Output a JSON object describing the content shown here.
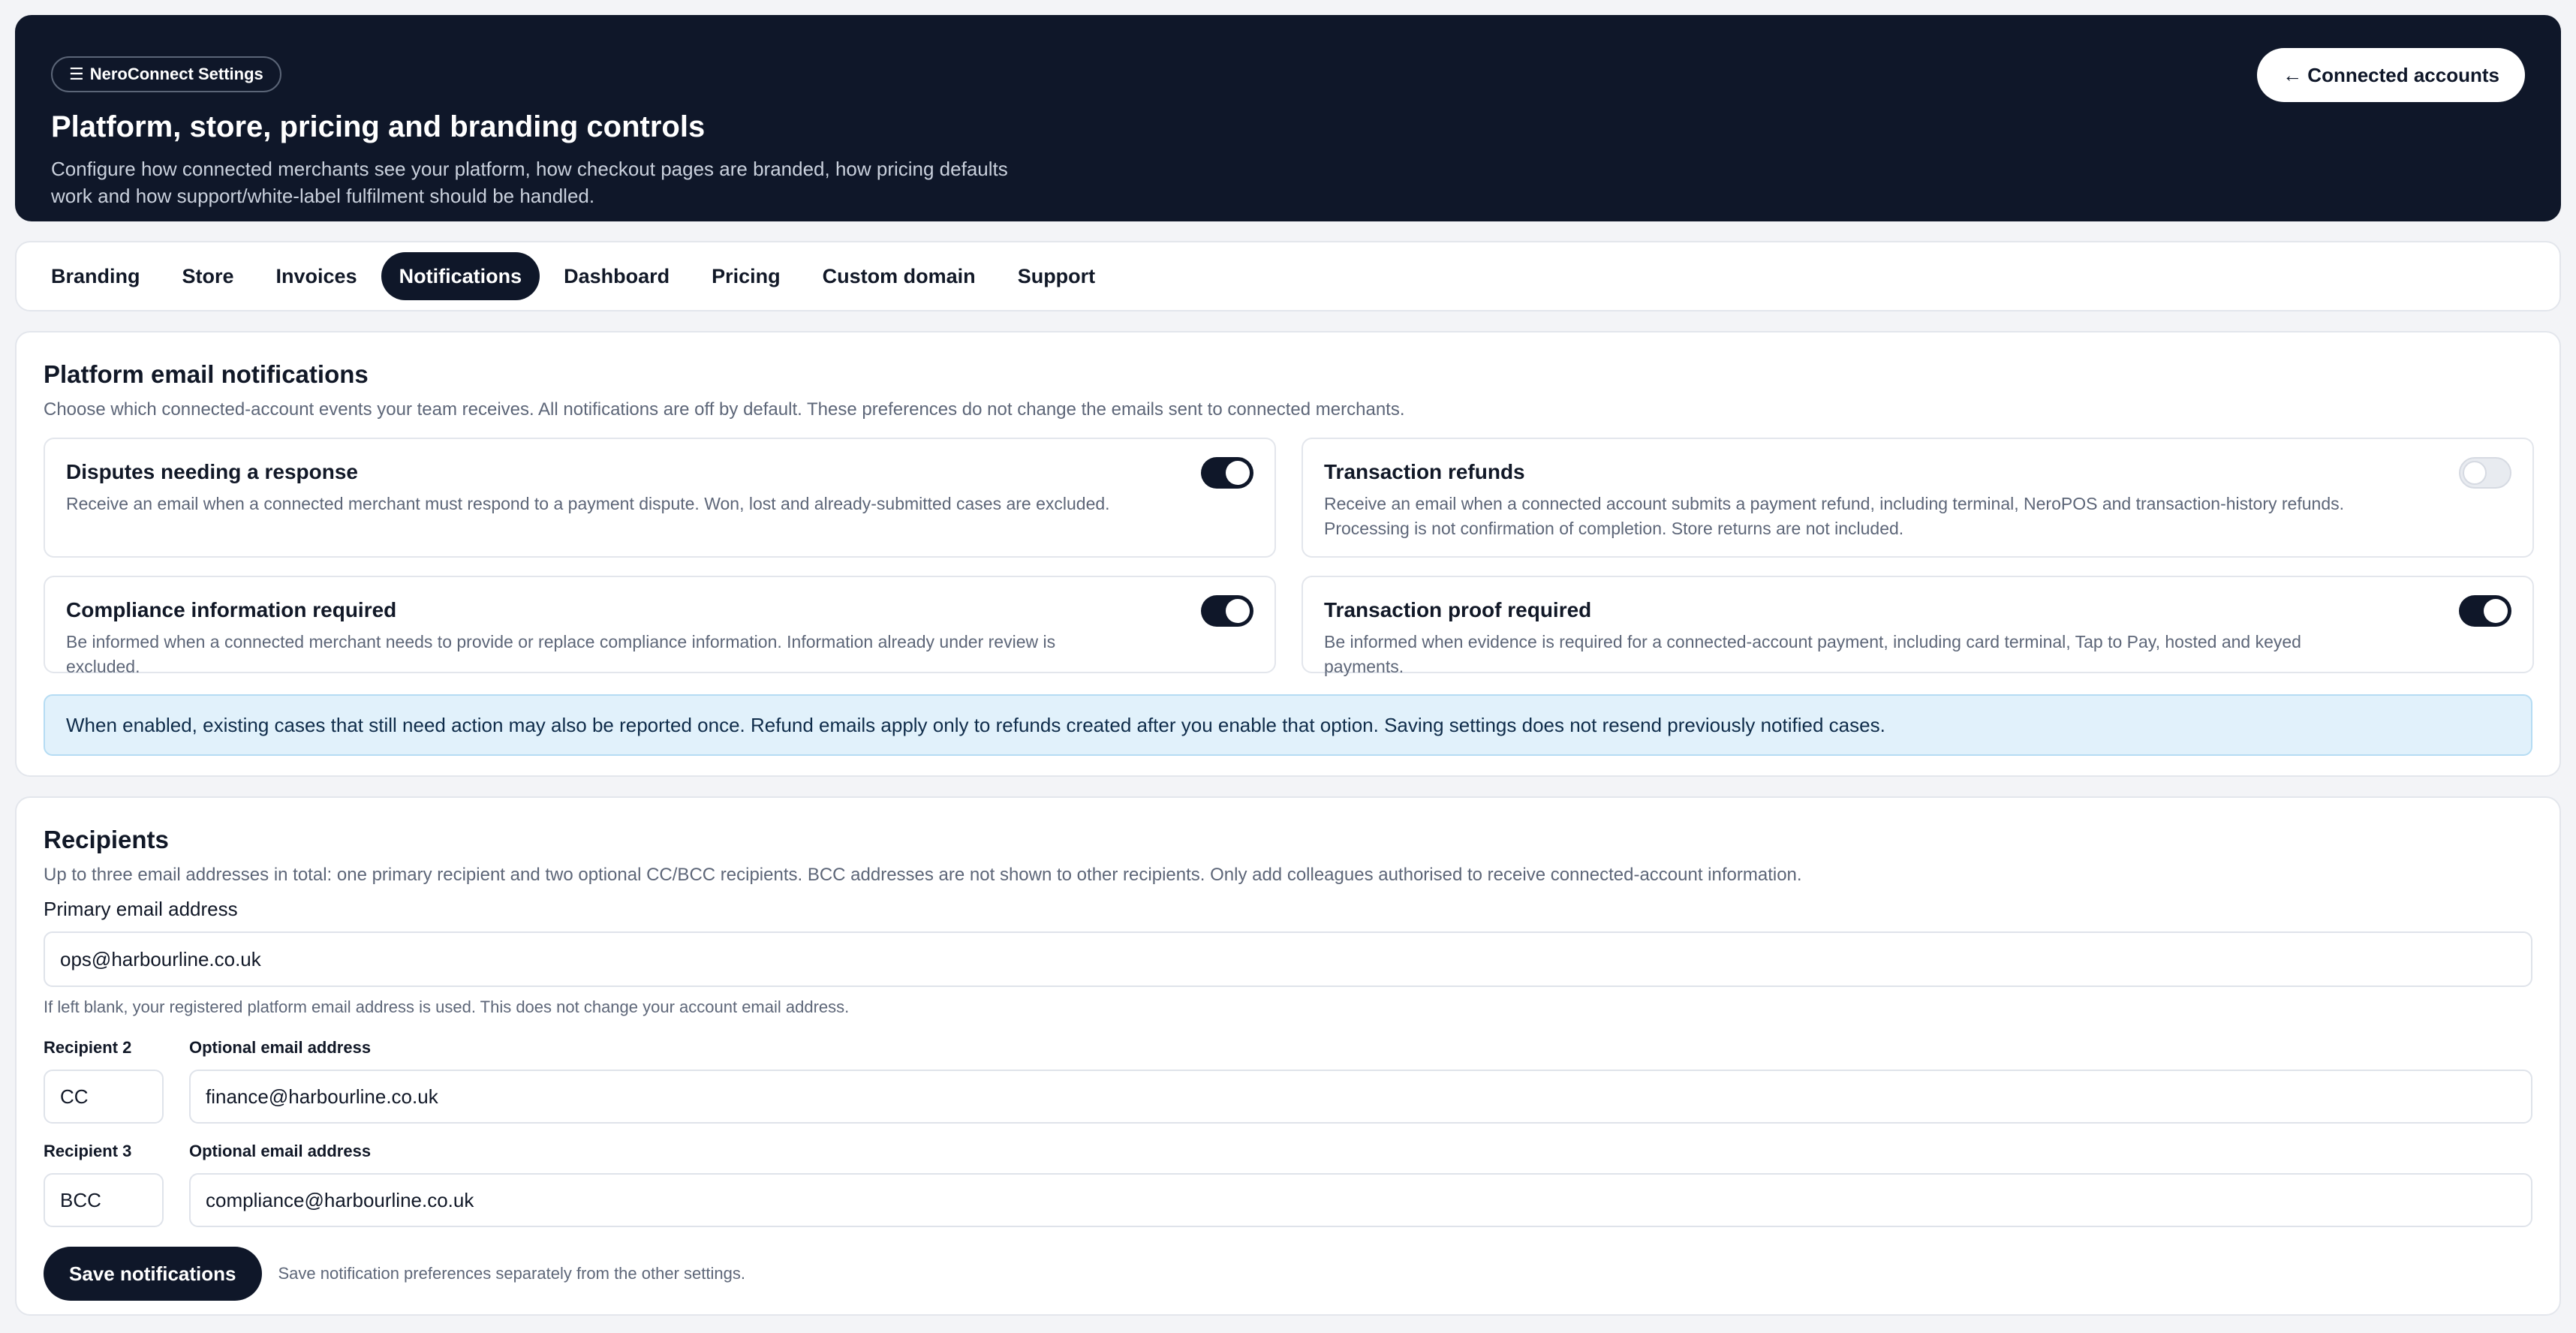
{
  "header": {
    "badge_icon": "menu-icon",
    "badge_label": "NeroConnect Settings",
    "title": "Platform, store, pricing and branding controls",
    "description": "Configure how connected merchants see your platform, how checkout pages are branded, how pricing defaults work and how support/white-label fulfilment should be handled.",
    "back_button": "← Connected accounts"
  },
  "tabs": [
    {
      "label": "Branding",
      "active": false
    },
    {
      "label": "Store",
      "active": false
    },
    {
      "label": "Invoices",
      "active": false
    },
    {
      "label": "Notifications",
      "active": true
    },
    {
      "label": "Dashboard",
      "active": false
    },
    {
      "label": "Pricing",
      "active": false
    },
    {
      "label": "Custom domain",
      "active": false
    },
    {
      "label": "Support",
      "active": false
    }
  ],
  "notifications": {
    "title": "Platform email notifications",
    "subtitle": "Choose which connected-account events your team receives. All notifications are off by default. These preferences do not change the emails sent to connected merchants.",
    "options": [
      {
        "title": "Disputes needing a response",
        "description": "Receive an email when a connected merchant must respond to a payment dispute. Won, lost and already-submitted cases are excluded.",
        "enabled": true
      },
      {
        "title": "Transaction refunds",
        "description": "Receive an email when a connected account submits a payment refund, including terminal, NeroPOS and transaction-history refunds. Processing is not confirmation of completion. Store returns are not included.",
        "enabled": false
      },
      {
        "title": "Compliance information required",
        "description": "Be informed when a connected merchant needs to provide or replace compliance information. Information already under review is excluded.",
        "enabled": true
      },
      {
        "title": "Transaction proof required",
        "description": "Be informed when evidence is required for a connected-account payment, including card terminal, Tap to Pay, hosted and keyed payments.",
        "enabled": true
      }
    ],
    "notice": "When enabled, existing cases that still need action may also be reported once. Refund emails apply only to refunds created after you enable that option. Saving settings does not resend previously notified cases."
  },
  "recipients": {
    "title": "Recipients",
    "subtitle": "Up to three email addresses in total: one primary recipient and two optional CC/BCC recipients. BCC addresses are not shown to other recipients. Only add colleagues authorised to receive connected-account information.",
    "primary_label": "Primary email address",
    "primary_value": "ops@harbourline.co.uk",
    "primary_hint": "If left blank, your registered platform email address is used. This does not change your account email address.",
    "rows": [
      {
        "label": "Recipient 2",
        "type": "CC",
        "email_label": "Optional email address",
        "email": "finance@harbourline.co.uk"
      },
      {
        "label": "Recipient 3",
        "type": "BCC",
        "email_label": "Optional email address",
        "email": "compliance@harbourline.co.uk"
      }
    ],
    "save_button": "Save notifications",
    "save_note": "Save notification preferences separately from the other settings."
  },
  "colors": {
    "navy": "#0f1729",
    "notice_bg": "#e1f1fb",
    "page_bg": "#f3f4f7"
  }
}
